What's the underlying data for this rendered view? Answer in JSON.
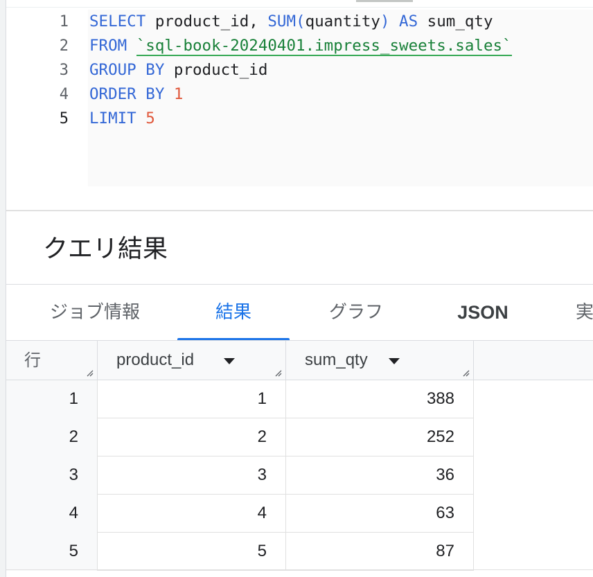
{
  "editor": {
    "line_numbers": [
      "1",
      "2",
      "3",
      "4",
      "5"
    ],
    "lines": [
      [
        {
          "t": "SELECT",
          "c": "kw"
        },
        {
          "t": " product_id, ",
          "c": ""
        },
        {
          "t": "SUM(",
          "c": "kw"
        },
        {
          "t": "quantity",
          "c": ""
        },
        {
          "t": ")",
          "c": "kw"
        },
        {
          "t": " ",
          "c": ""
        },
        {
          "t": "AS",
          "c": "kw"
        },
        {
          "t": " sum_qty",
          "c": ""
        }
      ],
      [
        {
          "t": "FROM",
          "c": "kw"
        },
        {
          "t": " ",
          "c": ""
        },
        {
          "t": "`sql-book-20240401.impress_sweets.sales`",
          "c": "str"
        }
      ],
      [
        {
          "t": "GROUP BY",
          "c": "kw"
        },
        {
          "t": " product_id",
          "c": ""
        }
      ],
      [
        {
          "t": "ORDER BY",
          "c": "kw"
        },
        {
          "t": " ",
          "c": ""
        },
        {
          "t": "1",
          "c": "num"
        }
      ],
      [
        {
          "t": "LIMIT",
          "c": "kw"
        },
        {
          "t": " ",
          "c": ""
        },
        {
          "t": "5",
          "c": "num"
        }
      ]
    ]
  },
  "results": {
    "title": "クエリ結果",
    "tabs": [
      {
        "label": "ジョブ情報"
      },
      {
        "label": "結果"
      },
      {
        "label": "グラフ"
      },
      {
        "label": "JSON"
      },
      {
        "label": "実"
      }
    ],
    "table": {
      "row_header": "行",
      "columns": [
        "product_id",
        "sum_qty"
      ],
      "rows": [
        {
          "row": "1",
          "product_id": "1",
          "sum_qty": "388"
        },
        {
          "row": "2",
          "product_id": "2",
          "sum_qty": "252"
        },
        {
          "row": "3",
          "product_id": "3",
          "sum_qty": "36"
        },
        {
          "row": "4",
          "product_id": "4",
          "sum_qty": "63"
        },
        {
          "row": "5",
          "product_id": "5",
          "sum_qty": "87"
        }
      ]
    }
  },
  "colors": {
    "keyword": "#3367d6",
    "number": "#e0573a",
    "string": "#188038",
    "accent": "#1a73e8"
  },
  "icons": [
    "sort-dropdown-icon",
    "column-resize-icon"
  ]
}
